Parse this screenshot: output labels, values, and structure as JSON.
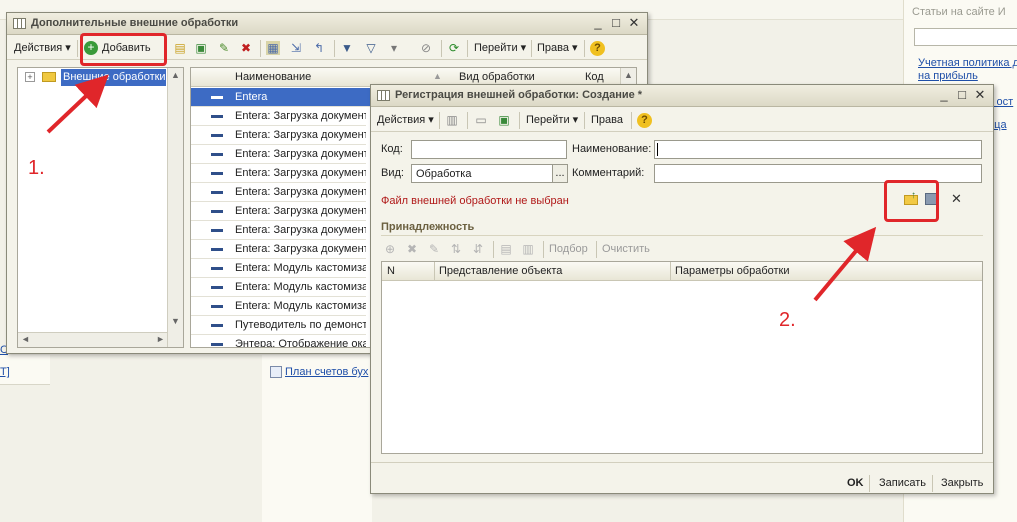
{
  "background": {
    "right_panel_title": "Статьи на сайте И",
    "right_links": [
      "Учетная политика д",
      "на прибыль",
      "х ост",
      "ица"
    ],
    "left_link": "Т]",
    "left_link2": "С",
    "center_link": "План счетов бух"
  },
  "window1": {
    "title": "Дополнительные внешние обработки",
    "toolbar": {
      "actions": "Действия",
      "add": "Добавить",
      "goto": "Перейти",
      "rights": "Права"
    },
    "tree": {
      "root": "Внешние обработки"
    },
    "columns": {
      "name": "Наименование",
      "kind": "Вид обработки",
      "code": "Код"
    },
    "rows": [
      "Entera",
      "Entera: Загрузка документ",
      "Entera: Загрузка документ",
      "Entera: Загрузка документ",
      "Entera: Загрузка документ",
      "Entera: Загрузка документ",
      "Entera: Загрузка документ",
      "Entera: Загрузка документ",
      "Entera: Загрузка документ",
      "Entera: Модуль кастомиза",
      "Entera: Модуль кастомиза",
      "Entera: Модуль кастомиза",
      "Путеводитель по демонстр",
      "Энтера: Отображение ока"
    ]
  },
  "window2": {
    "title": "Регистрация внешней обработки: Создание *",
    "toolbar": {
      "actions": "Действия",
      "goto": "Перейти",
      "rights": "Права"
    },
    "fields": {
      "code_label": "Код:",
      "code_value": "",
      "name_label": "Наименование:",
      "name_value": "",
      "kind_label": "Вид:",
      "kind_value": "Обработка",
      "kind_btn": "...",
      "comment_label": "Комментарий:",
      "comment_value": ""
    },
    "file_warning": "Файл внешней обработки не выбран",
    "membership_header": "Принадлежность",
    "grid_toolbar": {
      "pick": "Подбор",
      "clear": "Очистить"
    },
    "columns": {
      "n": "N",
      "object": "Представление объекта",
      "params": "Параметры обработки"
    },
    "footer": {
      "ok": "OK",
      "save": "Записать",
      "close": "Закрыть"
    }
  },
  "annotations": {
    "step1": "1.",
    "step2": "2.",
    "color": "#e0262a"
  }
}
